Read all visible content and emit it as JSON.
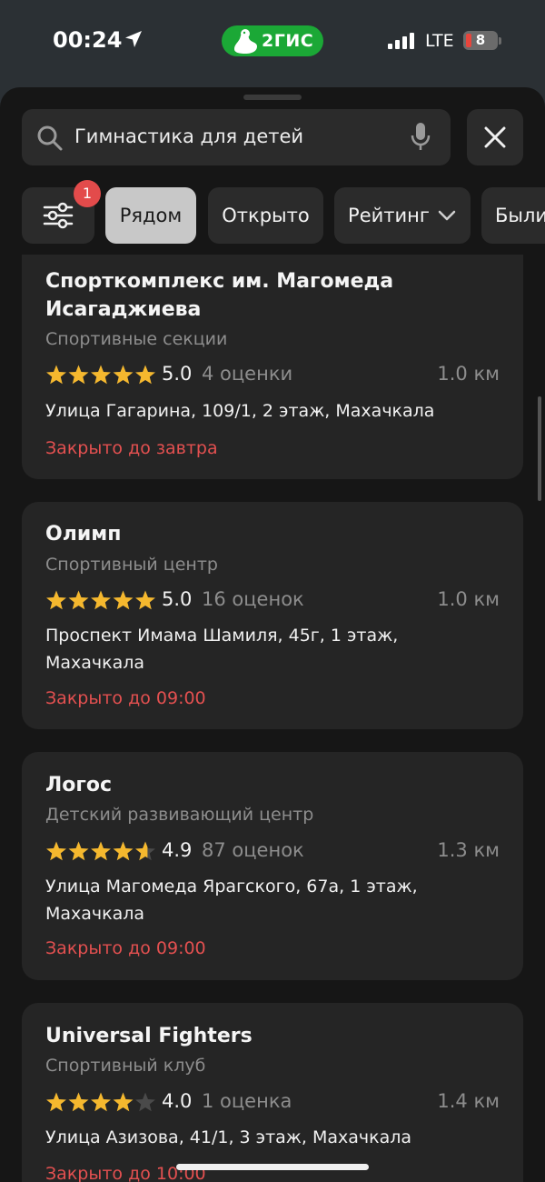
{
  "status_bar": {
    "time": "00:24",
    "brand": "2ГИС",
    "network": "LTE",
    "battery": "8"
  },
  "search": {
    "query": "Гимнастика для детей"
  },
  "filters": {
    "badge": "1",
    "chips": [
      "Рядом",
      "Открыто",
      "Рейтинг",
      "Были"
    ]
  },
  "results": [
    {
      "title_line1": "Спорткомплекс им. Магомеда",
      "title_line2": "Исагаджиева",
      "category": "Спортивные секции",
      "rating": "5.0",
      "stars": 5,
      "reviews": "4 оценки",
      "distance": "1.0 км",
      "address_line1": "Улица Гагарина, 109/1, 2 этаж, Махачкала",
      "hours": "Закрыто до завтра"
    },
    {
      "title": "Олимп",
      "category": "Спортивный центр",
      "rating": "5.0",
      "stars": 5,
      "reviews": "16 оценок",
      "distance": "1.0 км",
      "address_line1": "Проспект Имама Шамиля, 45г, 1 этаж,",
      "address_line2": "Махачкала",
      "hours": "Закрыто до 09:00"
    },
    {
      "title": "Логос",
      "category": "Детский развивающий центр",
      "rating": "4.9",
      "stars": 4.9,
      "reviews": "87 оценок",
      "distance": "1.3 км",
      "address_line1": "Улица Магомеда Ярагского, 67а, 1 этаж,",
      "address_line2": "Махачкала",
      "hours": "Закрыто до 09:00"
    },
    {
      "title": "Universal Fighters",
      "category": "Спортивный клуб",
      "rating": "4.0",
      "stars": 4,
      "reviews": "1 оценка",
      "distance": "1.4 км",
      "address_line1": "Улица Азизова, 41/1, 3 этаж, Махачкала",
      "hours": "Закрыто до 10:00"
    }
  ],
  "colors": {
    "brand_green": "#1ba836",
    "star_gold": "#f5b82e",
    "closed_red": "#e35050",
    "badge_red": "#e34b4b"
  }
}
